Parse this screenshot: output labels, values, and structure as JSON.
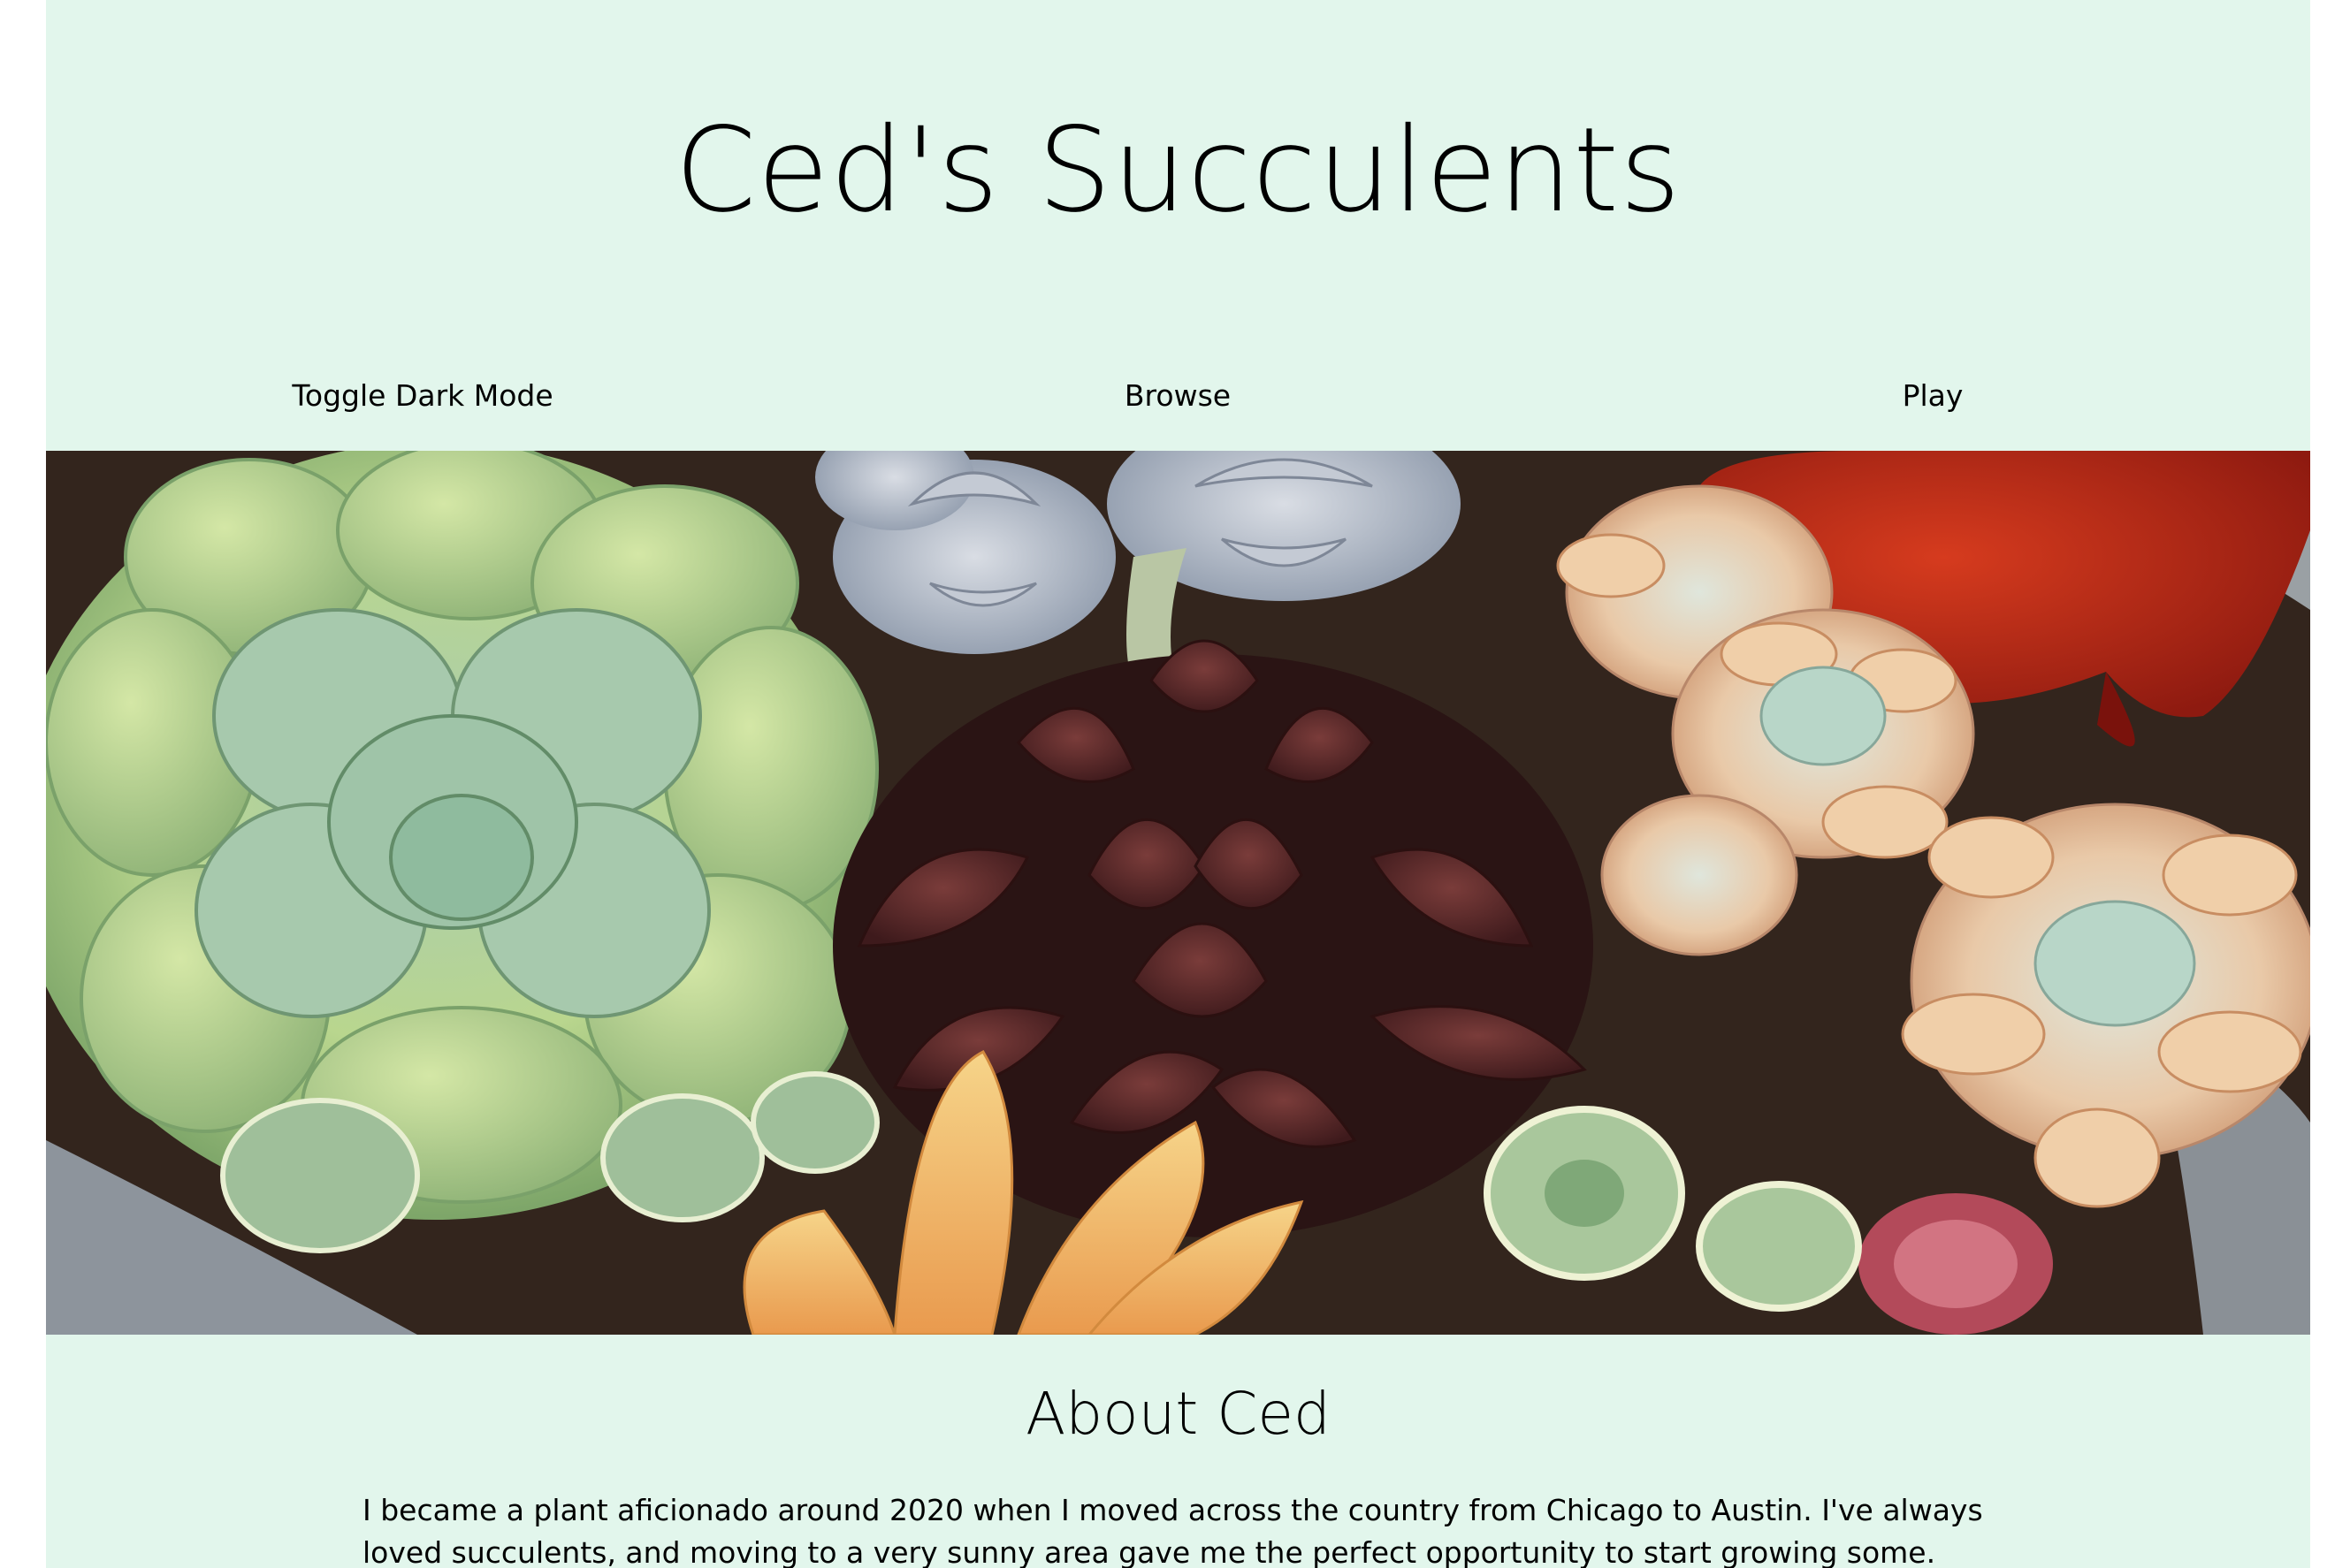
{
  "header": {
    "title": "Ced's Succulents"
  },
  "nav": {
    "items": [
      {
        "label": "Toggle Dark Mode"
      },
      {
        "label": "Browse"
      },
      {
        "label": "Play"
      }
    ]
  },
  "hero": {
    "alt": "succulents arrangement photo"
  },
  "about": {
    "heading": "About Ced",
    "text": "I became a plant aficionado around 2020 when I moved across the country from Chicago to Austin. I've always loved succulents, and moving to a very sunny area gave me the perfect opportunity to start growing some. When I first started"
  },
  "colors": {
    "page_background": "#e2f6ec",
    "text": "#000000"
  }
}
